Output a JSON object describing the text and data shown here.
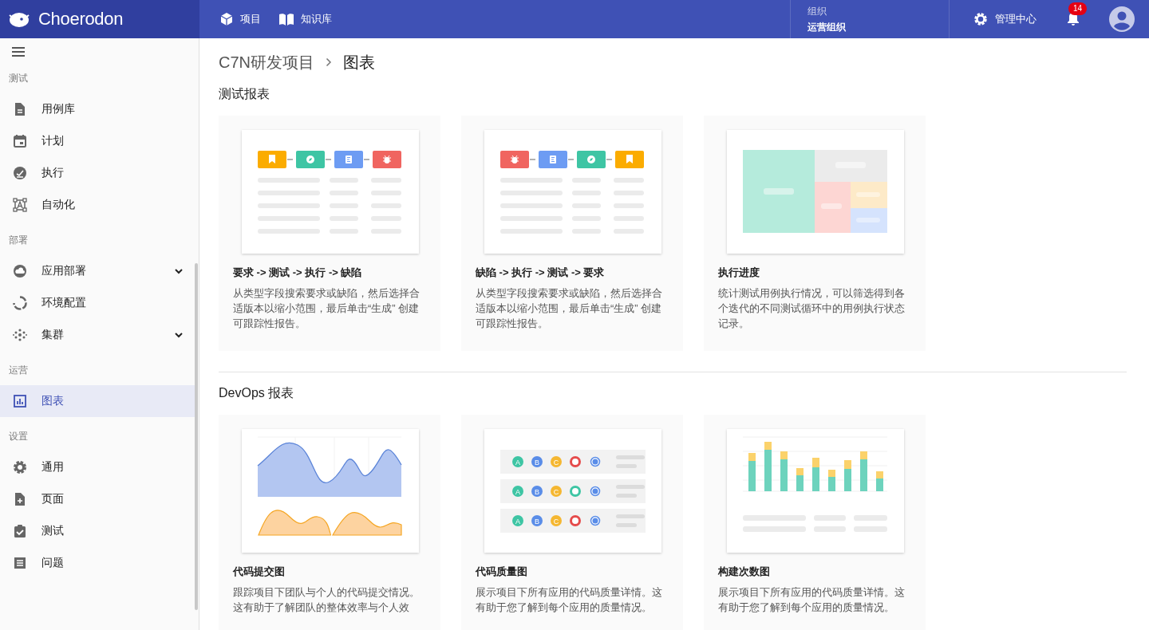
{
  "topbar": {
    "brand": "Choerodon",
    "nav": [
      {
        "label": "项目",
        "kind": "project"
      },
      {
        "label": "知识库",
        "kind": "wiki"
      }
    ],
    "org": {
      "label": "组织",
      "value": "运营组织"
    },
    "admin": {
      "label": "管理中心"
    },
    "notifications": {
      "count": "14"
    }
  },
  "sidebar": {
    "groups": [
      {
        "title": "测试",
        "items": [
          {
            "label": "用例库",
            "kind": "document",
            "selected": false,
            "has_submenu": false
          },
          {
            "label": "计划",
            "kind": "calendar",
            "selected": false,
            "has_submenu": false
          },
          {
            "label": "执行",
            "kind": "check-circle",
            "selected": false,
            "has_submenu": false
          },
          {
            "label": "自动化",
            "kind": "frame",
            "selected": false,
            "has_submenu": false
          }
        ]
      },
      {
        "title": "部署",
        "items": [
          {
            "label": "应用部署",
            "kind": "cloud",
            "selected": false,
            "has_submenu": true
          },
          {
            "label": "环境配置",
            "kind": "ring",
            "selected": false,
            "has_submenu": false
          },
          {
            "label": "集群",
            "kind": "dots",
            "selected": false,
            "has_submenu": true
          }
        ]
      },
      {
        "title": "运营",
        "items": [
          {
            "label": "图表",
            "kind": "chart",
            "selected": true,
            "has_submenu": false
          }
        ]
      },
      {
        "title": "设置",
        "items": [
          {
            "label": "通用",
            "kind": "gear",
            "selected": false,
            "has_submenu": false
          },
          {
            "label": "页面",
            "kind": "page-add",
            "selected": false,
            "has_submenu": false
          },
          {
            "label": "测试",
            "kind": "clipboard",
            "selected": false,
            "has_submenu": false
          },
          {
            "label": "问题",
            "kind": "list",
            "selected": false,
            "has_submenu": false
          }
        ]
      }
    ]
  },
  "breadcrumb": {
    "parent": "C7N研发项目",
    "current": "图表"
  },
  "sections": [
    {
      "title": "测试报表",
      "cards": [
        {
          "title": "要求 -> 测试 -> 执行 -> 缺陷",
          "description": "从类型字段搜索要求或缺陷，然后选择合适版本以缩小范围，最后单击“生成” 创建可跟踪性报告。",
          "preview": {
            "kind": "trace-forward"
          }
        },
        {
          "title": "缺陷 -> 执行 -> 测试 -> 要求",
          "description": "从类型字段搜索要求或缺陷，然后选择合适版本以缩小范围，最后单击“生成” 创建可跟踪性报告。",
          "preview": {
            "kind": "trace-reverse"
          }
        },
        {
          "title": "执行进度",
          "description": "统计测试用例执行情况，可以筛选得到各个迭代的不同测试循环中的用例执行状态记录。",
          "preview": {
            "kind": "treemap"
          }
        }
      ]
    },
    {
      "title": "DevOps 报表",
      "cards": [
        {
          "title": "代码提交图",
          "description": "跟踪项目下团队与个人的代码提交情况。这有助于了解团队的整体效率与个人效",
          "preview": {
            "kind": "area"
          }
        },
        {
          "title": "代码质量图",
          "description": "展示项目下所有应用的代码质量详情。这有助于您了解到每个应用的质量情况。",
          "preview": {
            "kind": "quality",
            "rows": [
              {
                "grades": [
                  "A",
                  "B",
                  "C"
                ]
              },
              {
                "grades": [
                  "A",
                  "B",
                  "C"
                ]
              },
              {
                "grades": [
                  "A",
                  "B",
                  "C"
                ]
              }
            ]
          }
        },
        {
          "title": "构建次数图",
          "description": "展示项目下所有应用的代码质量详情。这有助于您了解到每个应用的质量情况。",
          "preview": {
            "kind": "bars"
          }
        }
      ]
    }
  ]
}
